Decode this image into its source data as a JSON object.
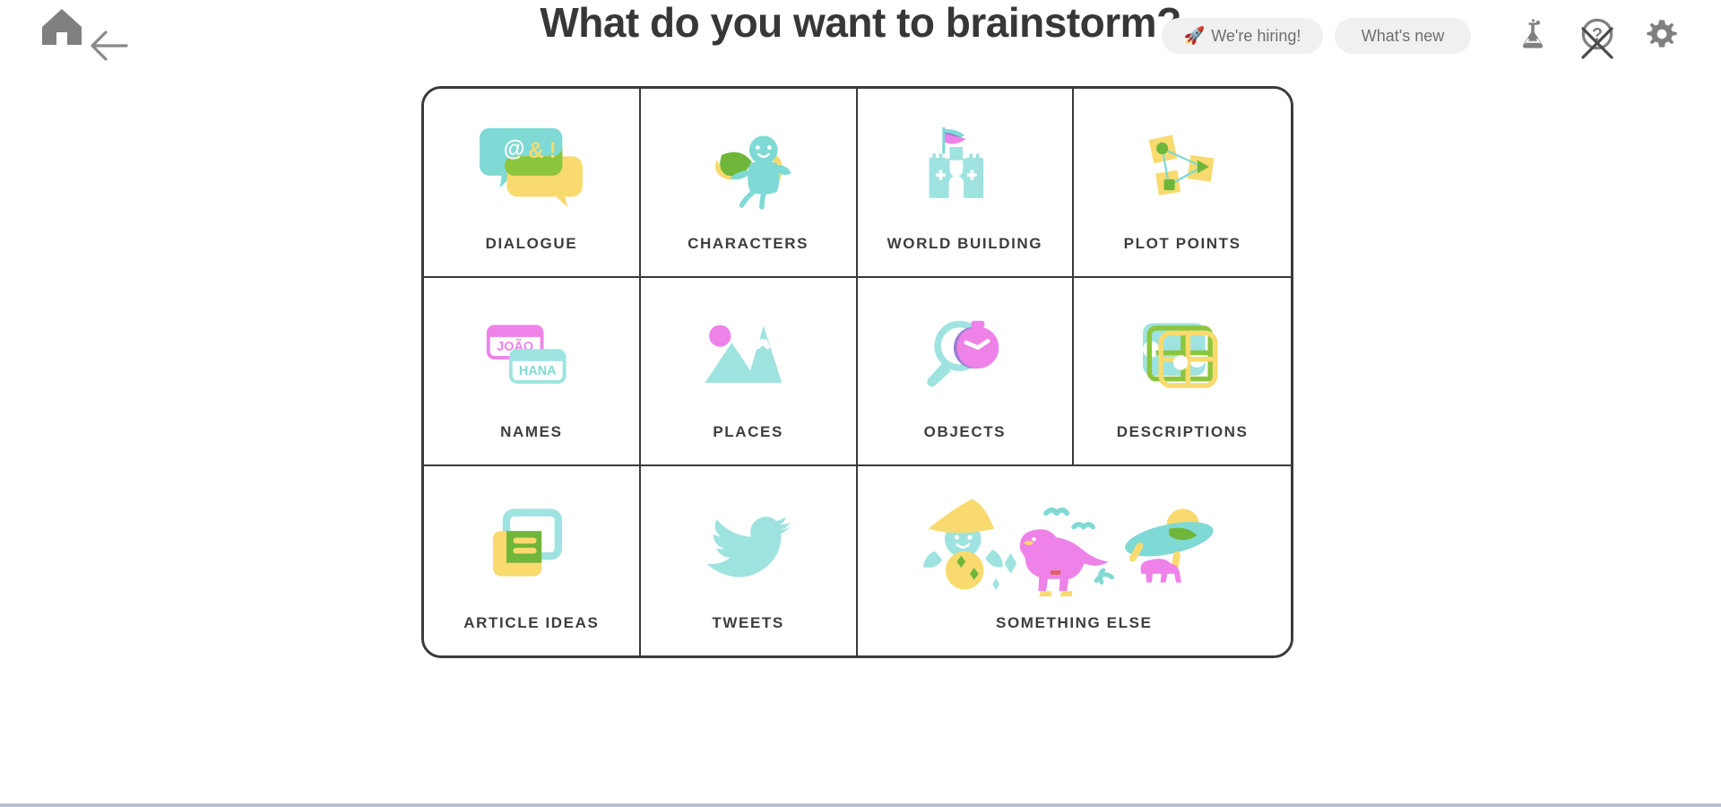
{
  "header": {
    "title": "What do you want to brainstorm?",
    "home_icon": "home-icon",
    "back_icon": "back-arrow-icon",
    "hiring_label": "We're hiring!",
    "hiring_emoji": "🚀",
    "whats_new_label": "What's new",
    "flask_icon": "flask-icon",
    "help_icon": "help-circle-icon",
    "gear_icon": "gear-icon"
  },
  "colors": {
    "teal": "#8ADEDC",
    "teal_light": "#A7E6E3",
    "yellow": "#F8DA6E",
    "green": "#8CC63E",
    "pink": "#EE82E8",
    "magenta": "#E86BD8",
    "purple": "#9B7FD4",
    "border": "#3a3a3a",
    "text": "#3d3d3d",
    "title": "#373737",
    "pill_bg": "#f0f0f0",
    "pill_text": "#6f6f6f",
    "footer_rule": "#b8c2cc"
  },
  "grid": {
    "cards": [
      {
        "label": "DIALOGUE",
        "art": "speech-bubbles-art"
      },
      {
        "label": "CHARACTERS",
        "art": "fairy-character-art"
      },
      {
        "label": "WORLD BUILDING",
        "art": "castle-art"
      },
      {
        "label": "PLOT POINTS",
        "art": "sticky-notes-network-art"
      },
      {
        "label": "NAMES",
        "art": "name-tags-art"
      },
      {
        "label": "PLACES",
        "art": "mountains-sun-art"
      },
      {
        "label": "OBJECTS",
        "art": "magnifier-stopwatch-art"
      },
      {
        "label": "DESCRIPTIONS",
        "art": "abstract-grid-art"
      },
      {
        "label": "ARTICLE IDEAS",
        "art": "article-cards-art"
      },
      {
        "label": "TWEETS",
        "art": "twitter-bird-art"
      },
      {
        "label": "SOMETHING ELSE",
        "art": "wizard-dino-ufo-art"
      }
    ],
    "name_tags": {
      "tag_one": "JOÃO",
      "tag_two": "HANA"
    },
    "dialogue_symbols": {
      "at": "@",
      "amp": "&",
      "bang": "!"
    }
  }
}
